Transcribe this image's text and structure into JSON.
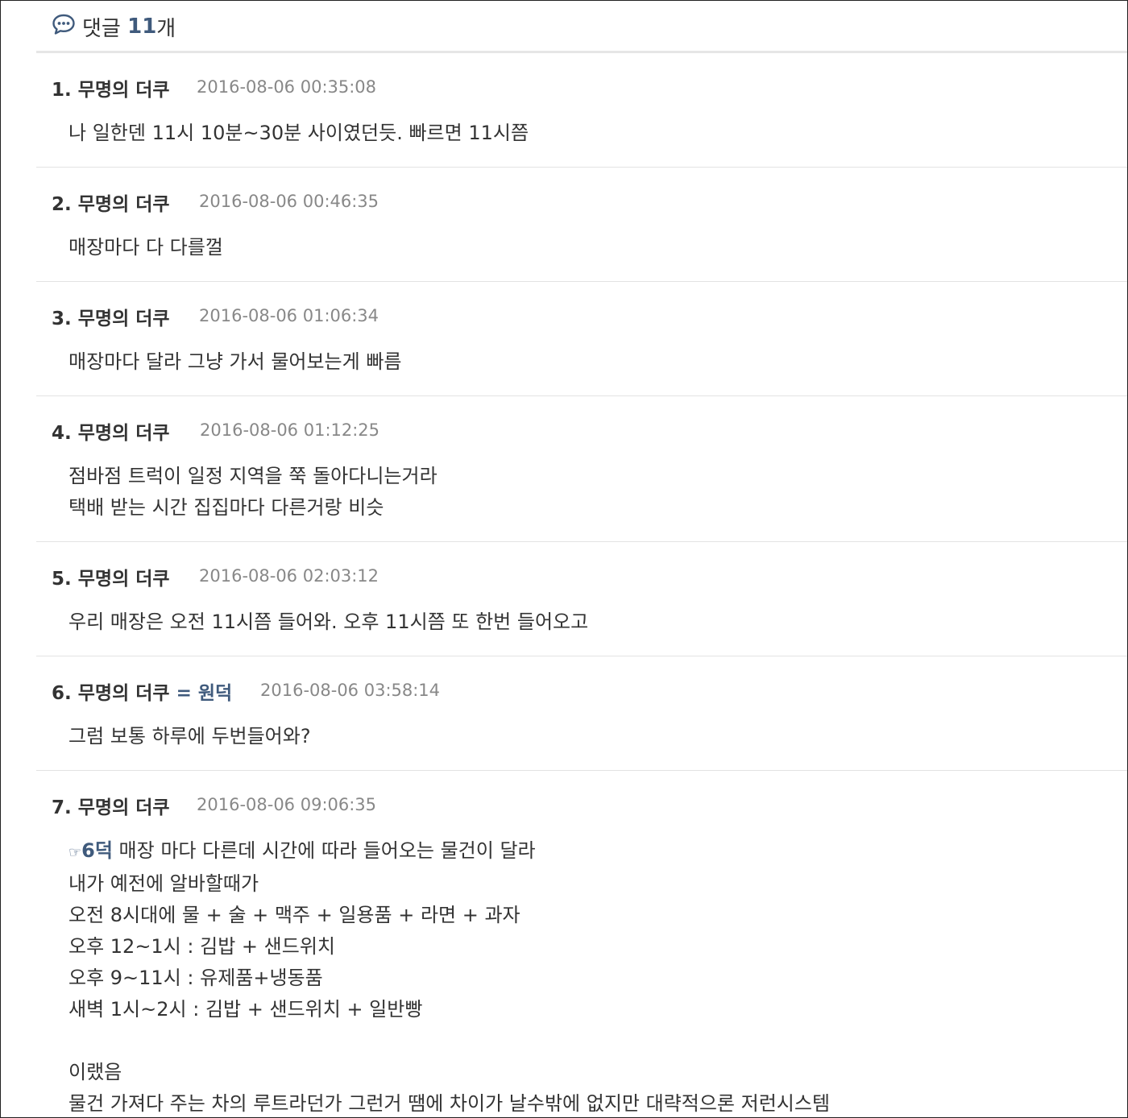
{
  "header": {
    "title": "댓글",
    "count": "11",
    "unit": "개"
  },
  "comments": [
    {
      "num": "1.",
      "author": "무명의 더쿠",
      "date": "2016-08-06 00:35:08",
      "lines": [
        "나 일한덴 11시 10분~30분 사이였던듯. 빠르면 11시쯤"
      ]
    },
    {
      "num": "2.",
      "author": "무명의 더쿠",
      "date": "2016-08-06 00:46:35",
      "lines": [
        "매장마다 다 다를껄"
      ]
    },
    {
      "num": "3.",
      "author": "무명의 더쿠",
      "date": "2016-08-06 01:06:34",
      "lines": [
        "매장마다 달라 그냥 가서 물어보는게 빠름"
      ]
    },
    {
      "num": "4.",
      "author": "무명의 더쿠",
      "date": "2016-08-06 01:12:25",
      "lines": [
        "점바점 트럭이 일정 지역을 쭉 돌아다니는거라",
        "택배 받는 시간 집집마다 다른거랑 비슷"
      ]
    },
    {
      "num": "5.",
      "author": "무명의 더쿠",
      "date": "2016-08-06 02:03:12",
      "lines": [
        "우리 매장은 오전 11시쯤 들어와. 오후 11시쯤 또 한번 들어오고"
      ]
    },
    {
      "num": "6.",
      "author": "무명의 더쿠",
      "author_tag": "= 원덕",
      "date": "2016-08-06 03:58:14",
      "lines": [
        "그럼 보통 하루에 두번들어와?"
      ]
    },
    {
      "num": "7.",
      "author": "무명의 더쿠",
      "date": "2016-08-06 09:06:35",
      "mention": {
        "hand": "☞",
        "label": "6덕"
      },
      "lines": [
        " 매장 마다 다른데 시간에 따라 들어오는 물건이 달라",
        "내가 예전에 알바할때가",
        "오전 8시대에 물 + 술 + 맥주 + 일용품 + 라면 + 과자",
        "오후 12~1시 : 김밥 + 샌드위치",
        "오후 9~11시 : 유제품+냉동품",
        "새벽 1시~2시 : 김밥 + 샌드위치 + 일반빵",
        "",
        "이랬음",
        "물건 가져다 주는 차의 루트라던가 그런거 땜에 차이가 날수밖에 없지만 대략적으론 저런시스템"
      ]
    }
  ]
}
